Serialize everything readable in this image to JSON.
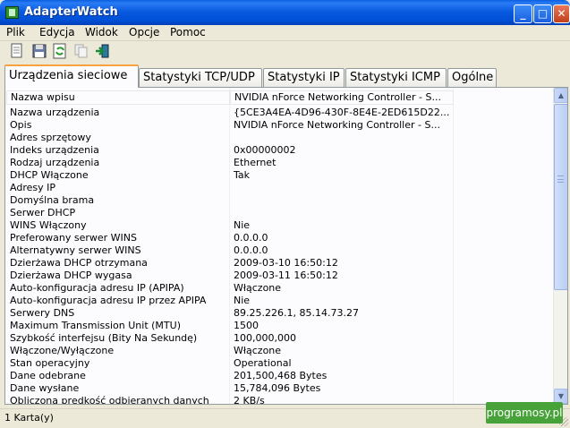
{
  "window": {
    "title": "AdapterWatch",
    "controls": {
      "minimize": "_",
      "maximize": "□",
      "close": "✕"
    }
  },
  "menu": [
    "Plik",
    "Edycja",
    "Widok",
    "Opcje",
    "Pomoc"
  ],
  "toolbar": {
    "icons": [
      "new-document-icon",
      "save-icon",
      "refresh-icon",
      "copy-icon",
      "exit-icon"
    ]
  },
  "tabs": [
    {
      "label": "Urządzenia sieciowe",
      "active": true
    },
    {
      "label": "Statystyki TCP/UDP",
      "active": false
    },
    {
      "label": "Statystyki IP",
      "active": false
    },
    {
      "label": "Statystyki ICMP",
      "active": false
    },
    {
      "label": "Ogólne",
      "active": false
    }
  ],
  "properties": [
    {
      "name": "Nazwa wpisu",
      "value": "NVIDIA nForce Networking Controller - S..."
    },
    {
      "name": "Nazwa urządzenia",
      "value": "{5CE3A4EA-4D96-430F-8E4E-2ED615D22..."
    },
    {
      "name": "Opis",
      "value": "NVIDIA nForce Networking Controller - S..."
    },
    {
      "name": "Adres sprzętowy",
      "value": ""
    },
    {
      "name": "Indeks urządzenia",
      "value": "0x00000002"
    },
    {
      "name": "Rodzaj urządzenia",
      "value": "Ethernet"
    },
    {
      "name": "DHCP Włączone",
      "value": "Tak"
    },
    {
      "name": "Adresy IP",
      "value": ""
    },
    {
      "name": "Domyślna brama",
      "value": ""
    },
    {
      "name": "Serwer DHCP",
      "value": ""
    },
    {
      "name": "WINS Włączony",
      "value": "Nie"
    },
    {
      "name": "Preferowany serwer WINS",
      "value": "0.0.0.0"
    },
    {
      "name": "Alternatywny serwer WINS",
      "value": "0.0.0.0"
    },
    {
      "name": "Dzierżawa DHCP otrzymana",
      "value": "2009-03-10 16:50:12"
    },
    {
      "name": "Dzierżawa DHCP wygasa",
      "value": "2009-03-11 16:50:12"
    },
    {
      "name": "Auto-konfiguracja adresu IP (APIPA)",
      "value": "Włączone"
    },
    {
      "name": "Auto-konfiguracja adresu IP przez APIPA",
      "value": "Nie"
    },
    {
      "name": "Serwery DNS",
      "value": "89.25.226.1, 85.14.73.27"
    },
    {
      "name": "Maximum Transmission Unit (MTU)",
      "value": "1500"
    },
    {
      "name": "Szybkość interfejsu (Bity Na Sekundę)",
      "value": "100,000,000"
    },
    {
      "name": "Włączone/Wyłączone",
      "value": "Włączone"
    },
    {
      "name": "Stan operacyjny",
      "value": "Operational"
    },
    {
      "name": "Dane odebrane",
      "value": "201,500,468 Bytes"
    },
    {
      "name": "Dane wysłane",
      "value": "15,784,096 Bytes"
    },
    {
      "name": "Obliczona prędkość odbieranych danych",
      "value": "2 KB/s"
    }
  ],
  "statusbar": {
    "text": "1 Karta(y)"
  },
  "watermark": "programosy.pl"
}
